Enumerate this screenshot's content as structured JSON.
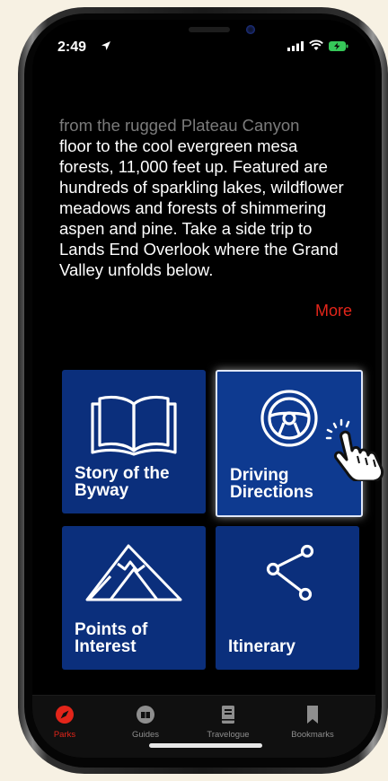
{
  "status": {
    "time": "2:49"
  },
  "description": {
    "faded_line": "from the rugged Plateau Canyon",
    "text": "floor to the cool evergreen mesa forests, 11,000 feet up. Featured are hundreds of sparkling lakes, wildflower meadows and forests of shimmering aspen and pine. Take a side trip to Lands End Overlook where the Grand Valley unfolds below.",
    "more_label": "More"
  },
  "tiles": [
    {
      "label": "Story of the\nByway",
      "icon": "open-book-icon"
    },
    {
      "label": "Driving\nDirections",
      "icon": "steering-wheel-icon"
    },
    {
      "label": "Points of\nInterest",
      "icon": "mountain-icon"
    },
    {
      "label": "Itinerary",
      "icon": "share-nodes-icon"
    }
  ],
  "tab_bar": {
    "items": [
      {
        "label": "Parks",
        "icon": "compass-icon",
        "active": true
      },
      {
        "label": "Guides",
        "icon": "guides-icon",
        "active": false
      },
      {
        "label": "Travelogue",
        "icon": "notebook-icon",
        "active": false
      },
      {
        "label": "Bookmarks",
        "icon": "bookmark-icon",
        "active": false
      }
    ]
  },
  "colors": {
    "accent": "#e3251a",
    "tile": "#0b2f7c",
    "background": "#000000"
  }
}
